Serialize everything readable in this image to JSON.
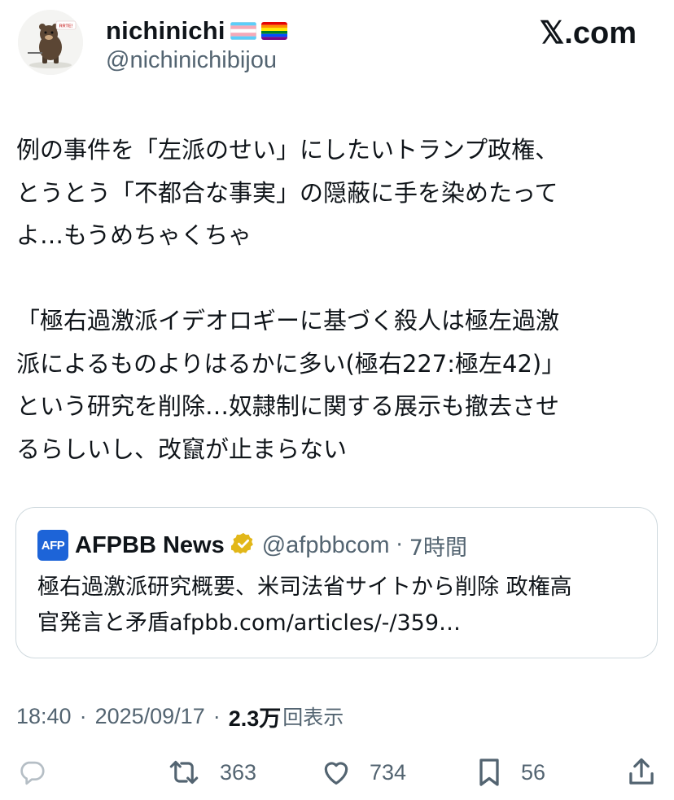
{
  "header": {
    "display_name": "nichinichi",
    "flags": [
      "transgender-flag",
      "rainbow-flag"
    ],
    "handle": "@nichinichibijou",
    "brand": "𝕏.com",
    "avatar_sign": "RRTE!"
  },
  "tweet": {
    "text": "例の事件を「左派のせい」にしたいトランプ政権、\nとうとう「不都合な事実」の隠蔽に手を染めたって\nよ…もうめちゃくちゃ\n\n「極右過激派イデオロギーに基づく殺人は極左過激\n派によるものよりはるかに多い(極右227:極左42)」\nという研究を削除…奴隷制に関する展示も撤去させ\nるらしいし、改竄が止まらない"
  },
  "quote": {
    "avatar_label": "AFP",
    "name": "AFPBB News",
    "verified": "gold-check-badge",
    "handle": "@afpbbcom",
    "separator": "·",
    "time": "7時間",
    "text": "極右過激派研究概要、米司法省サイトから削除 政権高\n官発言と矛盾afpbb.com/articles/-/359…"
  },
  "meta": {
    "time": "18:40",
    "dot1": "·",
    "date": "2025/09/17",
    "dot2": "·",
    "views_count": "2.3万",
    "views_label": "回表示"
  },
  "actions": {
    "reply_icon": "reply-icon",
    "retweet_count": "363",
    "like_count": "734",
    "bookmark_count": "56",
    "share_icon": "share-icon"
  },
  "colors": {
    "text_primary": "#0f1419",
    "text_secondary": "#536471",
    "border": "#cfd9de",
    "afp_blue": "#1d64d8",
    "verified_gold": "#e2b719"
  }
}
